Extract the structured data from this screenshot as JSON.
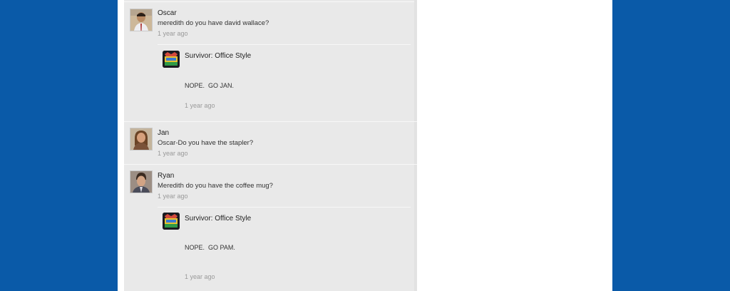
{
  "colors": {
    "background": "#0a5aa8",
    "page": "#ffffff",
    "feed": "#e9e9e9"
  },
  "posts": [
    {
      "author": "Oscar",
      "avatar_icon": "oscar-avatar-icon",
      "message": "meredith do you have david wallace?",
      "time": "1 year ago",
      "reply": {
        "author": "Survivor: Office Style",
        "logo_icon": "survivor-logo-icon",
        "message": "NOPE.  GO JAN.",
        "time": "1 year ago"
      }
    },
    {
      "author": "Jan",
      "avatar_icon": "jan-avatar-icon",
      "message": "Oscar-Do you have the stapler?",
      "time": "1 year ago"
    },
    {
      "author": "Ryan",
      "avatar_icon": "ryan-avatar-icon",
      "message": "Meredith do you have the coffee mug?",
      "time": "1 year ago",
      "reply": {
        "author": "Survivor: Office Style",
        "logo_icon": "survivor-logo-icon",
        "message": "NOPE.  GO PAM.",
        "time": "1 year ago"
      }
    }
  ]
}
